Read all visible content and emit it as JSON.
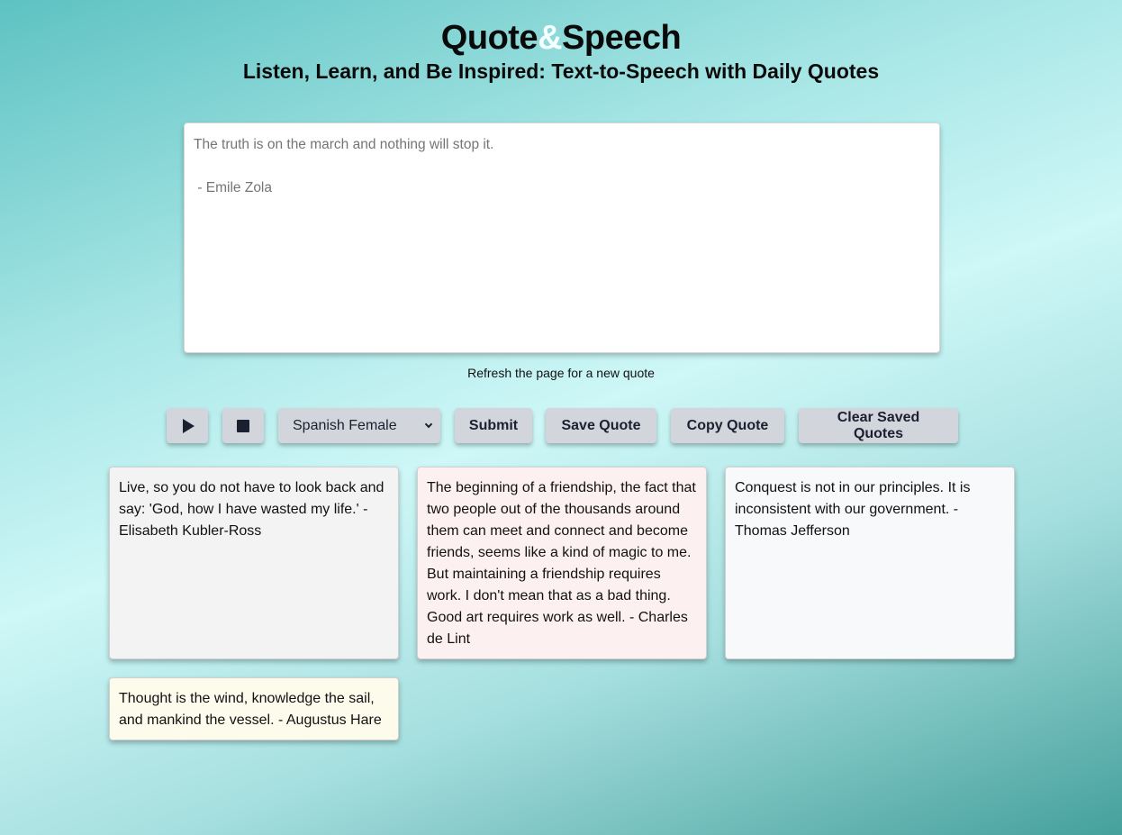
{
  "header": {
    "title_part1": "Quote",
    "title_amp": "&",
    "title_part2": "Speech",
    "subtitle": "Listen, Learn, and Be Inspired: Text-to-Speech with Daily Quotes"
  },
  "quote_box": {
    "placeholder": "The truth is on the march and nothing will stop it.\n\n - Emile Zola"
  },
  "hint": "Refresh the page for a new quote",
  "controls": {
    "play_icon": "play-icon",
    "stop_icon": "stop-icon",
    "voice_selected": "Spanish Female",
    "submit_label": "Submit",
    "save_label": "Save Quote",
    "copy_label": "Copy Quote",
    "clear_label": "Clear Saved Quotes"
  },
  "saved_quotes": [
    {
      "text": "Live, so you do not have to look back and say: 'God, how I have wasted my life.' - Elisabeth Kubler-Ross",
      "color": "#f3f3f4"
    },
    {
      "text": "The beginning of a friendship, the fact that two people out of the thousands around them can meet and connect and become friends, seems like a kind of magic to me. But maintaining a friendship requires work. I don't mean that as a bad thing. Good art requires work as well. - Charles de Lint",
      "color": "#fdf0f1"
    },
    {
      "text": "Conquest is not in our principles. It is inconsistent with our government. - Thomas Jefferson",
      "color": "#f8f9fa"
    },
    {
      "text": "Thought is the wind, knowledge the sail, and mankind the vessel. - Augustus Hare",
      "color": "#fdfbec"
    }
  ]
}
